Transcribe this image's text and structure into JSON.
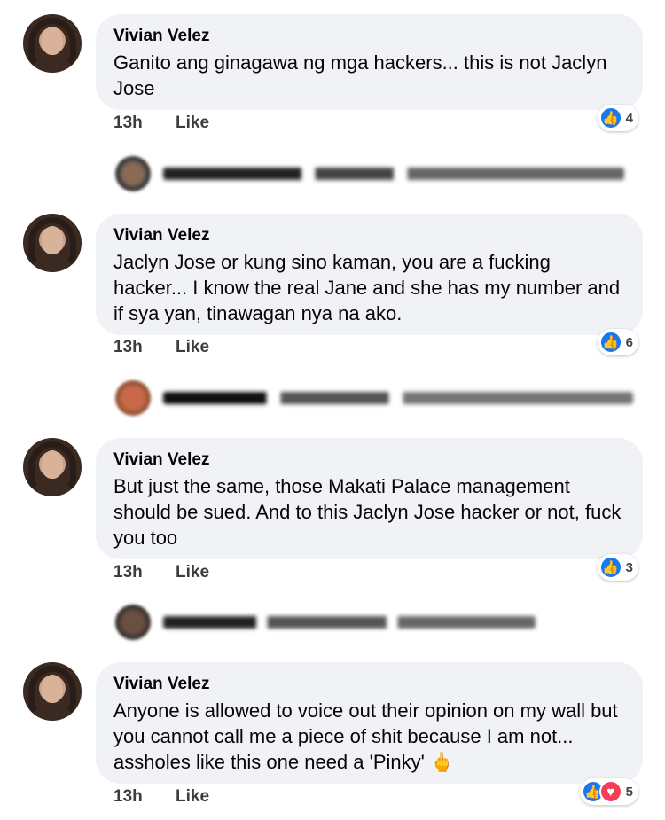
{
  "comments": [
    {
      "author": "Vivian Velez",
      "text": "Ganito ang ginagawa ng mga hackers... this is not Jaclyn Jose",
      "time": "13h",
      "like_label": "Like",
      "reaction_count": "4",
      "reactions": [
        "like"
      ]
    },
    {
      "author": "Vivian Velez",
      "text": "Jaclyn Jose or kung sino kaman, you are a fucking hacker... I know the real Jane and she has my number and if sya yan, tinawagan nya na ako.",
      "time": "13h",
      "like_label": "Like",
      "reaction_count": "6",
      "reactions": [
        "like"
      ]
    },
    {
      "author": "Vivian Velez",
      "text": "But just the same, those Makati Palace management should be sued. And to this Jaclyn Jose hacker or not, fuck you too",
      "time": "13h",
      "like_label": "Like",
      "reaction_count": "3",
      "reactions": [
        "like"
      ]
    },
    {
      "author": "Vivian Velez",
      "text": "Anyone is allowed to voice out their opinion on my wall but you cannot call me a piece of shit because I am not... assholes like this one need a 'Pinky'",
      "emoji": "🖕",
      "time": "13h",
      "like_label": "Like",
      "reaction_count": "5",
      "reactions": [
        "like",
        "love"
      ]
    }
  ],
  "icons": {
    "like": "thumbs-up-icon",
    "love": "heart-icon"
  },
  "colors": {
    "like_blue": "#1877f2",
    "love_red": "#f33e58",
    "bubble_bg": "#f0f2f5"
  }
}
